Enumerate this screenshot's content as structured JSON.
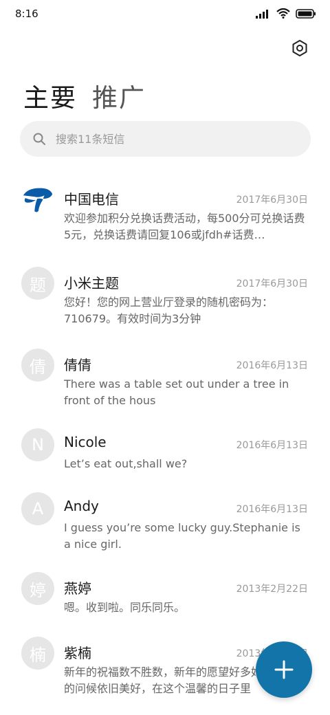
{
  "status_bar": {
    "time": "8:16"
  },
  "header": {
    "tabs": [
      {
        "label": "主要"
      },
      {
        "label": "推广"
      }
    ]
  },
  "search": {
    "placeholder": "搜索11条短信"
  },
  "conversations": [
    {
      "avatar": "",
      "name": "中国电信",
      "date": "2017年6月30日",
      "preview": "欢迎参加积分兑换话费活动，每500分可兑换话费5元，兑换话费请回复106或jfdh#话费…"
    },
    {
      "avatar": "题",
      "name": "小米主题",
      "date": "2017年6月30日",
      "preview": "您好！您的网上营业厅登录的随机密码为：710679。有效时间为3分钟"
    },
    {
      "avatar": "倩",
      "name": "倩倩",
      "date": "2016年6月13日",
      "preview": "There was a table set out under a tree in front of the hous"
    },
    {
      "avatar": "N",
      "name": "Nicole",
      "date": "2016年6月13日",
      "preview": "Let’s eat out,shall we?"
    },
    {
      "avatar": "A",
      "name": "Andy",
      "date": "2016年6月13日",
      "preview": "I guess you’re some lucky guy.Stephanie is a nice girl."
    },
    {
      "avatar": "婷",
      "name": "燕婷",
      "date": "2013年2月22日",
      "preview": "嗯。收到啦。同乐同乐。"
    },
    {
      "avatar": "楠",
      "name": "紫楠",
      "date": "2013年2月22日",
      "preview": "新年的祝福数不胜数，新年的愿望好多好多，新年的问候依旧美好，在这个温馨的日子里"
    }
  ],
  "fab": {
    "icon": "plus-icon"
  },
  "colors": {
    "accent": "#1274a8",
    "brand_logo": "#0a5ca8"
  }
}
